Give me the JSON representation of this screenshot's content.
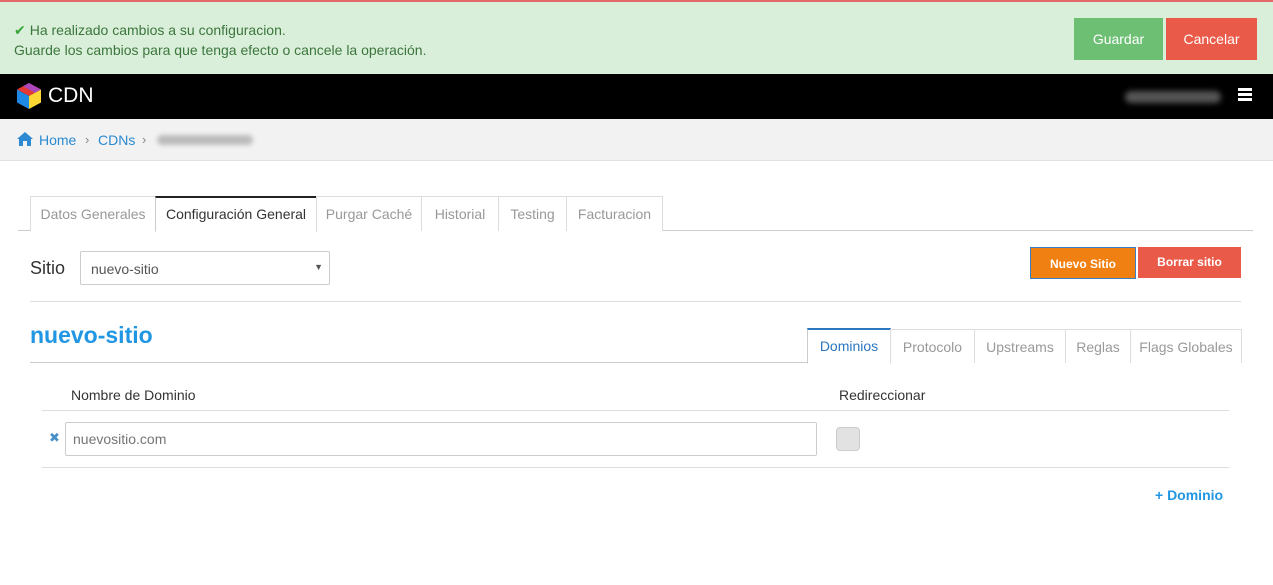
{
  "alert": {
    "line1": "Ha realizado cambios a su configuracion.",
    "line2": "Guarde los cambios para que tenga efecto o cancele la operación.",
    "save_label": "Guardar",
    "cancel_label": "Cancelar"
  },
  "navbar": {
    "brand": "CDN"
  },
  "breadcrumb": {
    "home": "Home",
    "cdns": "CDNs"
  },
  "tabs": [
    {
      "label": "Datos Generales"
    },
    {
      "label": "Configuración General"
    },
    {
      "label": "Purgar Caché"
    },
    {
      "label": "Historial"
    },
    {
      "label": "Testing"
    },
    {
      "label": "Facturacion"
    }
  ],
  "sitio": {
    "label": "Sitio",
    "selected": "nuevo-sitio",
    "new_label": "Nuevo Sitio",
    "delete_label": "Borrar sitio"
  },
  "site": {
    "title": "nuevo-sitio"
  },
  "subtabs": [
    {
      "label": "Dominios"
    },
    {
      "label": "Protocolo"
    },
    {
      "label": "Upstreams"
    },
    {
      "label": "Reglas"
    },
    {
      "label": "Flags Globales"
    }
  ],
  "domains": {
    "col_name": "Nombre de Dominio",
    "col_redirect": "Redireccionar",
    "rows": [
      {
        "placeholder": "nuevositio.com"
      }
    ],
    "add_label": "+ Dominio"
  },
  "colors": {
    "alert_bg": "#d9efd9",
    "save": "#6cbf73",
    "cancel": "#ea5a48",
    "accent": "#2196e3",
    "new_site": "#f08012"
  }
}
